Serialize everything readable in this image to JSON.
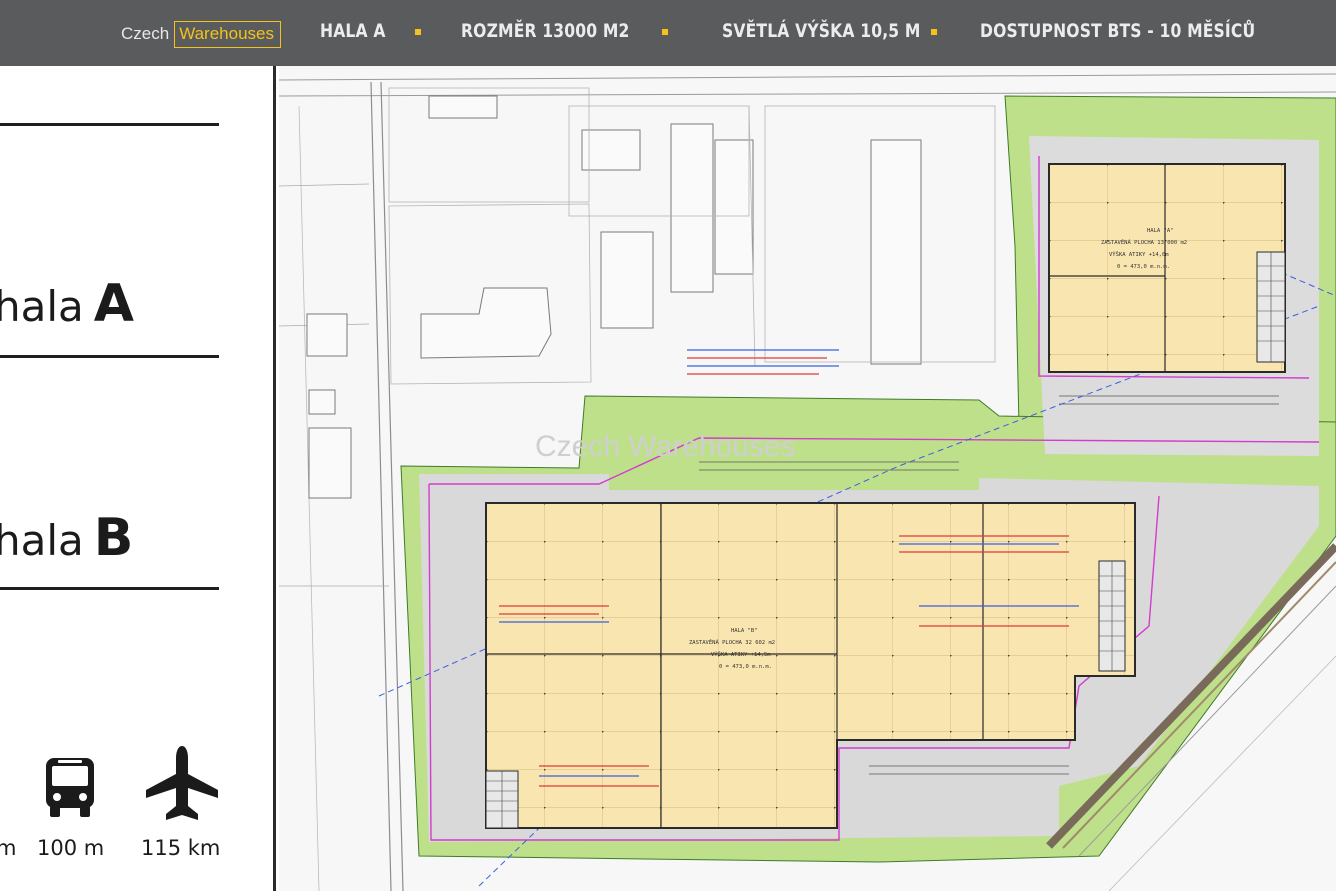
{
  "header": {
    "brand_czech": "Czech",
    "brand_warehouses": "Warehouses",
    "nav": [
      "HALA A",
      "ROZMĚR 13000 M2",
      "SVĚTLÁ VÝŠKA  10,5 M",
      "DOSTUPNOST BTS - 10 MĚSÍCŮ"
    ]
  },
  "sidebar": {
    "hala_a_word": "hala",
    "hala_a_letter": "A",
    "hala_b_word": "hala",
    "hala_b_letter": "B",
    "distances": [
      "m",
      "100 m",
      "115 km"
    ],
    "icons": [
      "bus-icon",
      "airplane-icon"
    ]
  },
  "plan": {
    "watermark": "Czech Warehouses",
    "hall_b_label": "HALA \"B\"",
    "hall_b_area": "ZASTAVĚNÁ PLOCHA 32 602 m2",
    "hall_b_height": "VÝŠKA ATIKY +14,5m",
    "hall_b_level": "0 = 473,0 m.n.m.",
    "hall_a_label": "HALA \"A\"",
    "hall_a_area": "ZASTAVĚNÁ PLOCHA 13 000 m2",
    "hall_a_height": "VÝŠKA ATIKY +14,0m",
    "hall_a_level": "0 = 473,0 m.n.m."
  },
  "colors": {
    "topbar": "#5a5b5d",
    "accent": "#f3c21b",
    "hall_fill": "#f9e5b0",
    "green_zone": "#b9dc7c"
  }
}
